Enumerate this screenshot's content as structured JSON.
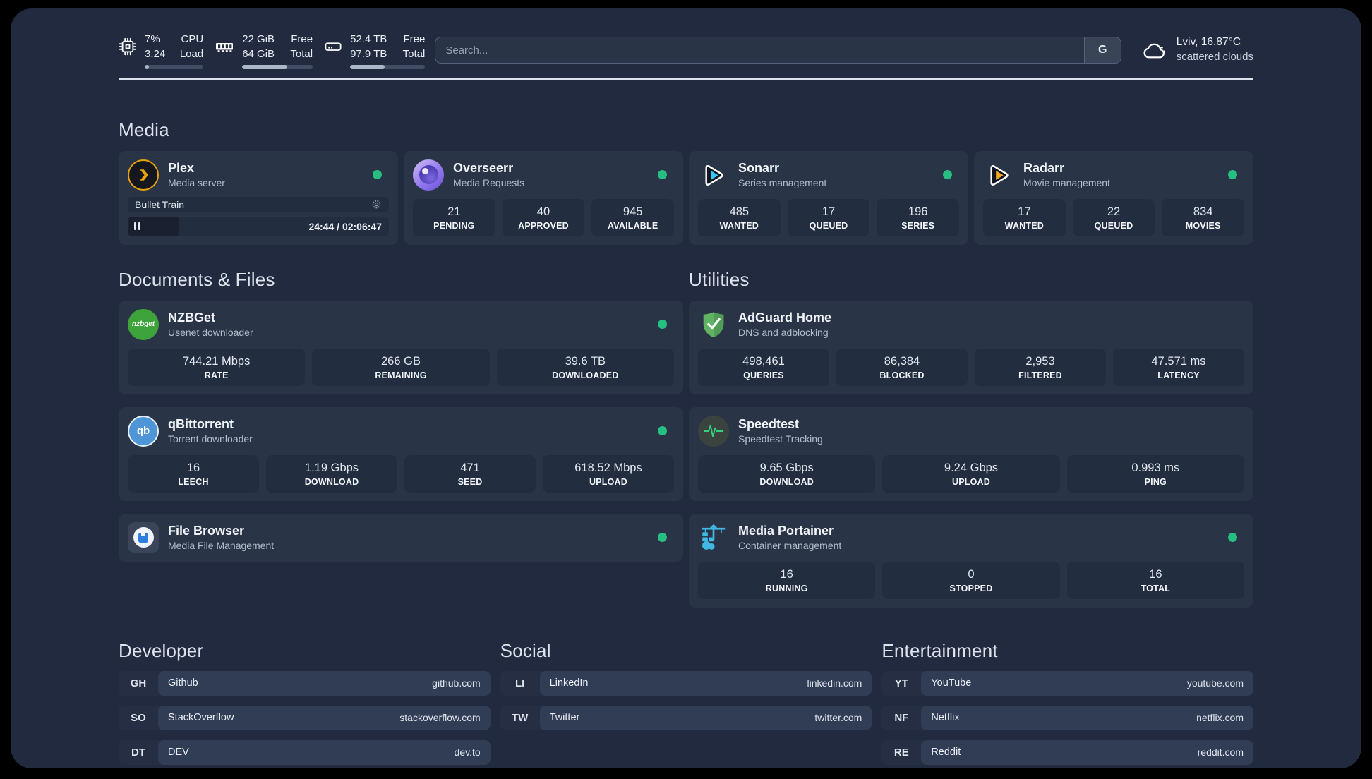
{
  "header": {
    "cpu": {
      "icon": "cpu-chip-icon",
      "values": [
        "7%",
        "3.24"
      ],
      "labels": [
        "CPU",
        "Load"
      ],
      "progress_percent": 7
    },
    "memory": {
      "icon": "ram-icon",
      "values": [
        "22 GiB",
        "64 GiB"
      ],
      "labels": [
        "Free",
        "Total"
      ],
      "progress_percent": 64
    },
    "storage": {
      "icon": "hdd-icon",
      "values": [
        "52.4 TB",
        "97.9 TB"
      ],
      "labels": [
        "Free",
        "Total"
      ],
      "progress_percent": 46
    },
    "search": {
      "placeholder": "Search...",
      "engine_button": "G"
    },
    "weather": {
      "icon": "cloud-icon",
      "location": "Lviv, 16.87°C",
      "condition": "scattered clouds"
    }
  },
  "sections": {
    "media": {
      "title": "Media",
      "apps": [
        {
          "name": "Plex",
          "subtitle": "Media server",
          "icon": "plex-icon",
          "online": true,
          "now_playing": {
            "title": "Bullet Train",
            "time": "24:44 / 02:06:47",
            "progress_percent": 19.6
          }
        },
        {
          "name": "Overseerr",
          "subtitle": "Media Requests",
          "icon": "overseerr-icon",
          "online": true,
          "stats": [
            {
              "value": "21",
              "label": "PENDING"
            },
            {
              "value": "40",
              "label": "APPROVED"
            },
            {
              "value": "945",
              "label": "AVAILABLE"
            }
          ]
        },
        {
          "name": "Sonarr",
          "subtitle": "Series management",
          "icon": "sonarr-icon",
          "online": true,
          "stats": [
            {
              "value": "485",
              "label": "WANTED"
            },
            {
              "value": "17",
              "label": "QUEUED"
            },
            {
              "value": "196",
              "label": "SERIES"
            }
          ]
        },
        {
          "name": "Radarr",
          "subtitle": "Movie management",
          "icon": "radarr-icon",
          "online": true,
          "stats": [
            {
              "value": "17",
              "label": "WANTED"
            },
            {
              "value": "22",
              "label": "QUEUED"
            },
            {
              "value": "834",
              "label": "MOVIES"
            }
          ]
        }
      ]
    },
    "documents": {
      "title": "Documents & Files",
      "apps": [
        {
          "name": "NZBGet",
          "subtitle": "Usenet downloader",
          "icon": "nzbget-icon",
          "online": true,
          "stats": [
            {
              "value": "744.21 Mbps",
              "label": "RATE"
            },
            {
              "value": "266 GB",
              "label": "REMAINING"
            },
            {
              "value": "39.6 TB",
              "label": "DOWNLOADED"
            }
          ]
        },
        {
          "name": "qBittorrent",
          "subtitle": "Torrent downloader",
          "icon": "qbittorrent-icon",
          "online": true,
          "stats": [
            {
              "value": "16",
              "label": "LEECH"
            },
            {
              "value": "1.19 Gbps",
              "label": "DOWNLOAD"
            },
            {
              "value": "471",
              "label": "SEED"
            },
            {
              "value": "618.52 Mbps",
              "label": "UPLOAD"
            }
          ]
        },
        {
          "name": "File Browser",
          "subtitle": "Media File Management",
          "icon": "filebrowser-icon",
          "online": true
        }
      ]
    },
    "utilities": {
      "title": "Utilities",
      "apps": [
        {
          "name": "AdGuard Home",
          "subtitle": "DNS and adblocking",
          "icon": "adguard-icon",
          "stats": [
            {
              "value": "498,461",
              "label": "QUERIES"
            },
            {
              "value": "86,384",
              "label": "BLOCKED"
            },
            {
              "value": "2,953",
              "label": "FILTERED"
            },
            {
              "value": "47.571 ms",
              "label": "LATENCY"
            }
          ]
        },
        {
          "name": "Speedtest",
          "subtitle": "Speedtest Tracking",
          "icon": "speedtest-icon",
          "stats": [
            {
              "value": "9.65 Gbps",
              "label": "DOWNLOAD"
            },
            {
              "value": "9.24 Gbps",
              "label": "UPLOAD"
            },
            {
              "value": "0.993 ms",
              "label": "PING"
            }
          ]
        },
        {
          "name": "Media Portainer",
          "subtitle": "Container management",
          "icon": "portainer-icon",
          "online": true,
          "stats": [
            {
              "value": "16",
              "label": "RUNNING"
            },
            {
              "value": "0",
              "label": "STOPPED"
            },
            {
              "value": "16",
              "label": "TOTAL"
            }
          ]
        }
      ]
    },
    "bookmarks": [
      {
        "title": "Developer",
        "items": [
          {
            "abbr": "GH",
            "name": "Github",
            "url": "github.com"
          },
          {
            "abbr": "SO",
            "name": "StackOverflow",
            "url": "stackoverflow.com"
          },
          {
            "abbr": "DT",
            "name": "DEV",
            "url": "dev.to"
          }
        ]
      },
      {
        "title": "Social",
        "items": [
          {
            "abbr": "LI",
            "name": "LinkedIn",
            "url": "linkedin.com"
          },
          {
            "abbr": "TW",
            "name": "Twitter",
            "url": "twitter.com"
          }
        ]
      },
      {
        "title": "Entertainment",
        "items": [
          {
            "abbr": "YT",
            "name": "YouTube",
            "url": "youtube.com"
          },
          {
            "abbr": "NF",
            "name": "Netflix",
            "url": "netflix.com"
          },
          {
            "abbr": "RE",
            "name": "Reddit",
            "url": "reddit.com"
          }
        ]
      }
    ]
  },
  "colors": {
    "background": "#212A3F",
    "card": "#2A3447",
    "tile": "#232D40",
    "status_online": "#27BE81",
    "plex_amber": "#E9A20C",
    "sonarr_cyan": "#38C6F4",
    "radarr_amber": "#F7A825",
    "nzbget_green": "#3FA33C",
    "qbittorrent_blue": "#4E96D8",
    "adguard_green": "#5FB363",
    "speedtest_pulse": "#35D07F",
    "portainer_blue": "#41B9E5",
    "overseerr_purple": "#6A4FD8"
  }
}
